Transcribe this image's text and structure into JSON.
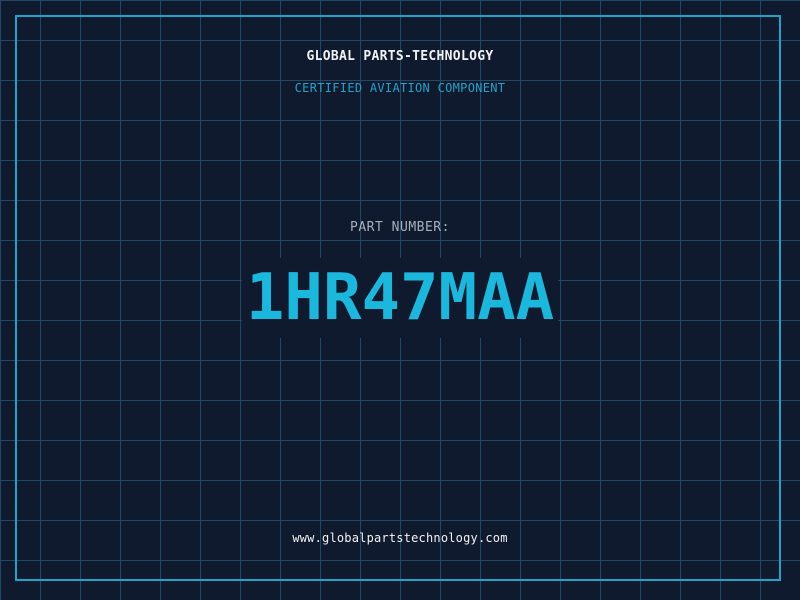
{
  "header": {
    "company": "GLOBAL PARTS-TECHNOLOGY",
    "tagline": "CERTIFIED AVIATION COMPONENT"
  },
  "part": {
    "label": "PART NUMBER:",
    "number": "1HR47MAA"
  },
  "footer": {
    "website": "www.globalpartstechnology.com"
  },
  "colors": {
    "background": "#0f1a2e",
    "grid": "#1f4a66",
    "accent": "#1fa3c7",
    "part_number": "#1ab8dc",
    "text": "#f2f2f2",
    "label": "#a8b0bd"
  }
}
